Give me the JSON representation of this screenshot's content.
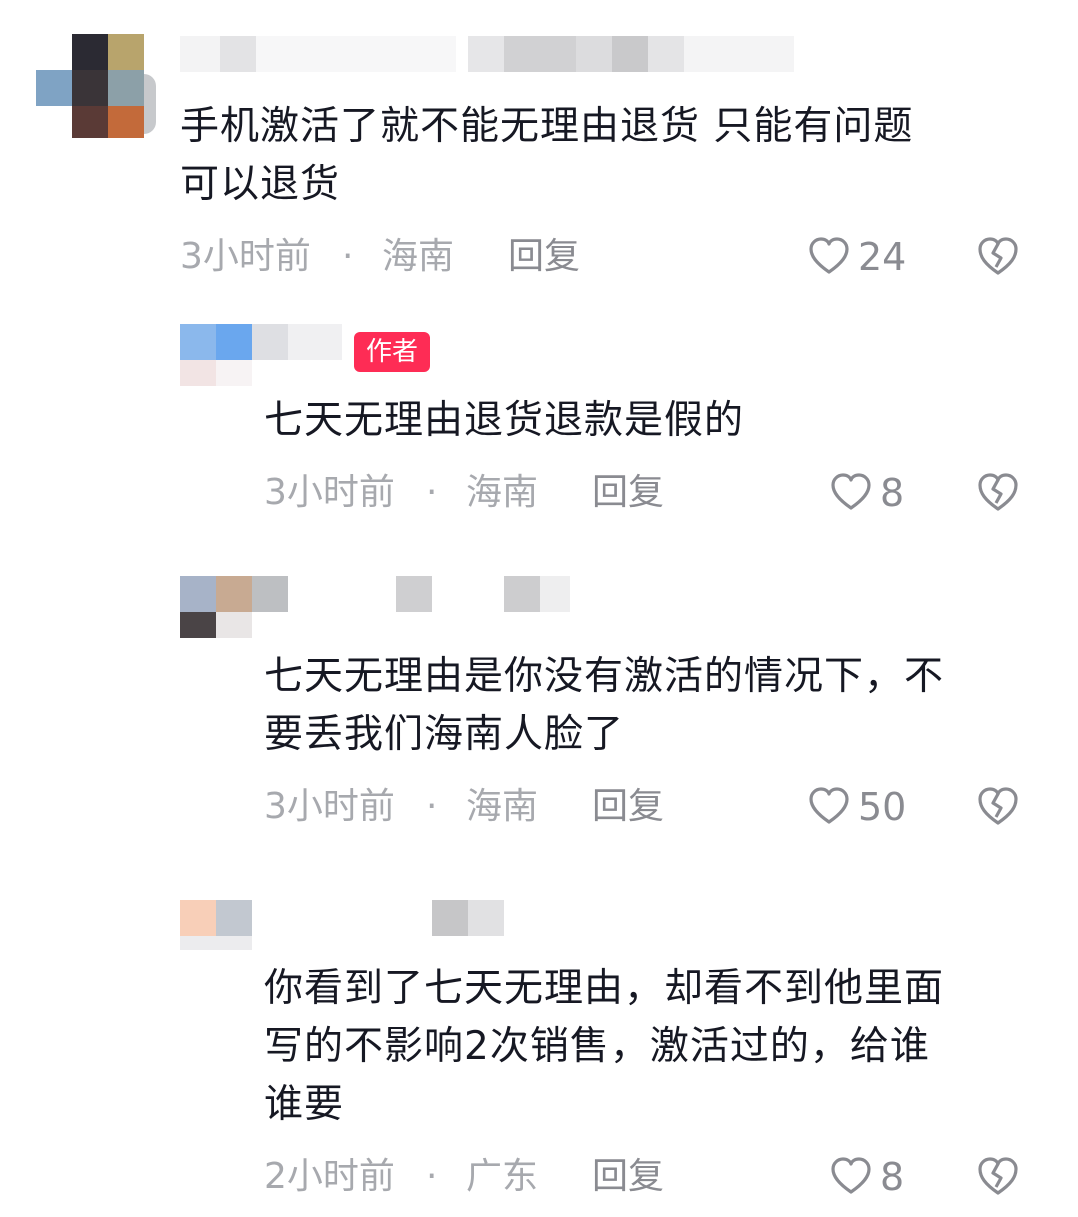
{
  "comments": [
    {
      "text": "手机激活了就不能无理由退货 只能有问题\n可以退货",
      "time": "3小时前",
      "sep": "·",
      "location": "海南",
      "reply": "回复",
      "likes": "24"
    },
    {
      "badge": "作者",
      "text": "七天无理由退货退款是假的",
      "time": "3小时前",
      "sep": "·",
      "location": "海南",
      "reply": "回复",
      "likes": "8"
    },
    {
      "text": "七天无理由是你没有激活的情况下，不\n要丢我们海南人脸了",
      "time": "3小时前",
      "sep": "·",
      "location": "海南",
      "reply": "回复",
      "likes": "50"
    },
    {
      "text": "你看到了七天无理由，却看不到他里面\n写的不影响2次销售，激活过的，给谁\n谁要",
      "time": "2小时前",
      "sep": "·",
      "location": "广东",
      "reply": "回复",
      "likes": "8"
    }
  ],
  "icons": {
    "like": "heart-outline-icon",
    "dislike": "broken-heart-icon"
  },
  "colors": {
    "text": "#161823",
    "meta": "#a7a9ae",
    "badge": "#fe2c55"
  }
}
